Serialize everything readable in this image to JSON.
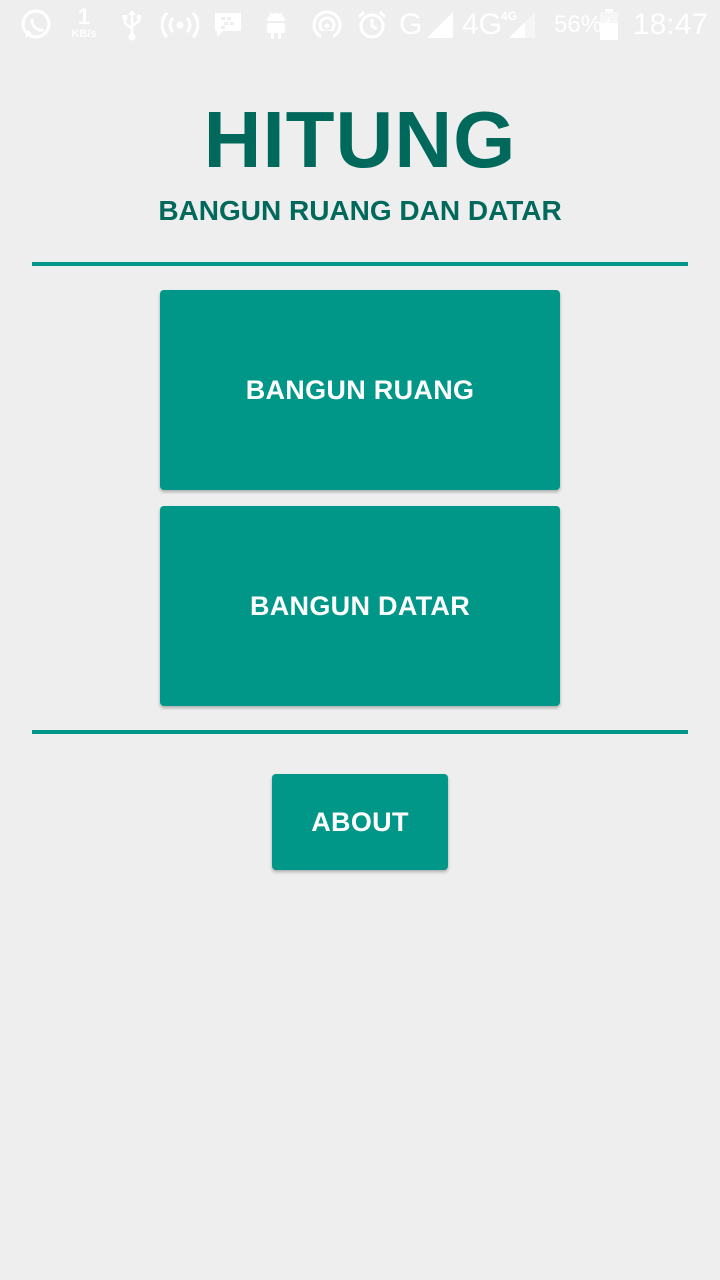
{
  "status_bar": {
    "speed_value": "1",
    "speed_unit": "KB/s",
    "network_g": "G",
    "network_4g": "4G",
    "network_4g_small": "4G",
    "battery_percent": "56%",
    "time": "18:47",
    "icons": [
      "whatsapp-icon",
      "usb-icon",
      "hotspot-icon",
      "bbm-icon",
      "android-icon",
      "wifi-off-icon",
      "alarm-icon",
      "signal-icon",
      "battery-charging-icon"
    ]
  },
  "header": {
    "title": "HITUNG",
    "subtitle": "BANGUN RUANG DAN DATAR"
  },
  "menu": {
    "bangun_ruang_label": "BANGUN RUANG",
    "bangun_datar_label": "BANGUN DATAR"
  },
  "footer": {
    "about_label": "ABOUT"
  },
  "colors": {
    "primary": "#009688",
    "primary_dark": "#00695c",
    "background": "#eeeeee",
    "button_text": "#ffffff"
  }
}
